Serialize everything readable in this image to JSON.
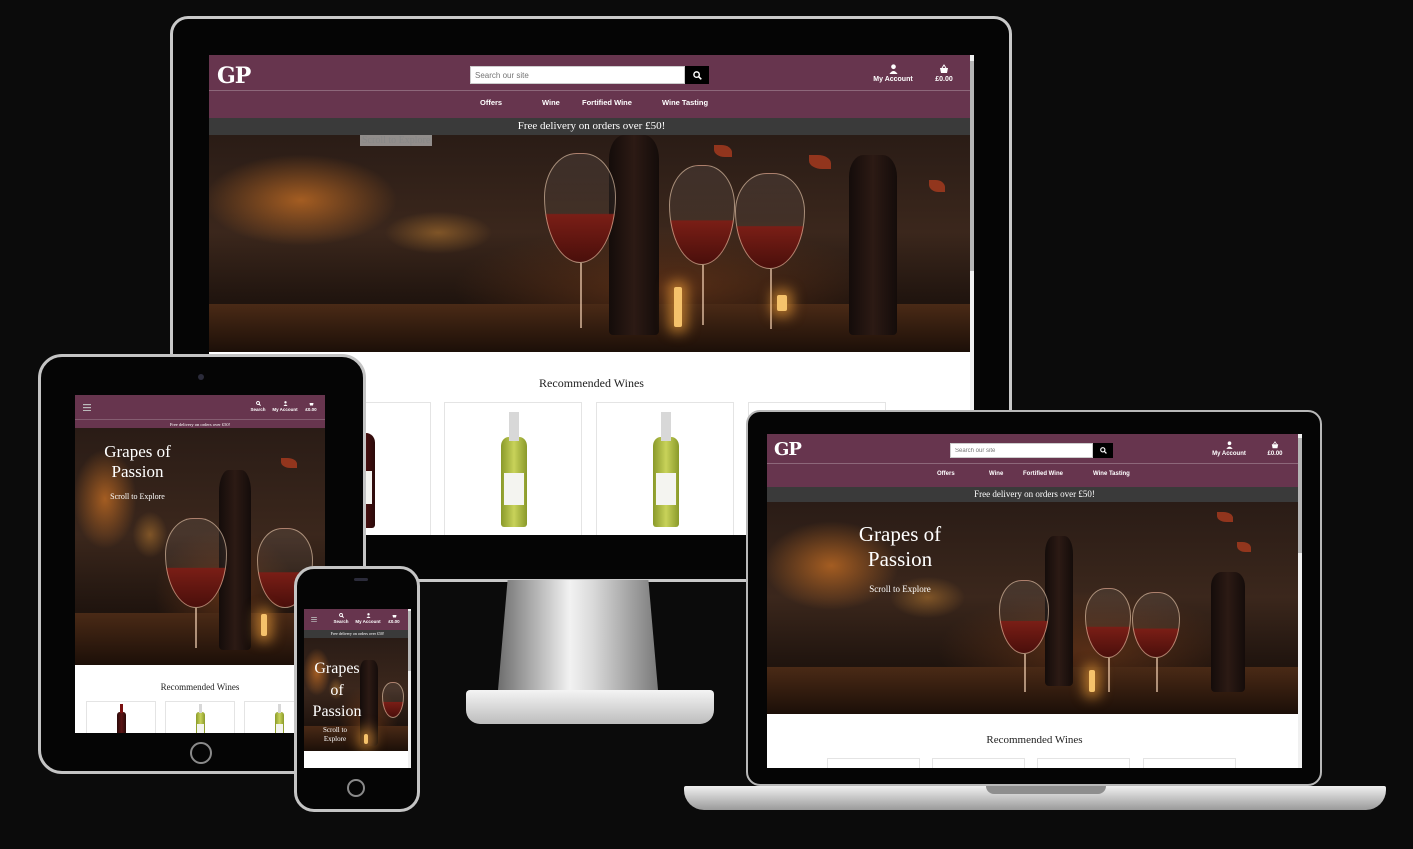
{
  "brand": {
    "logo_text": "GP",
    "primary_color": "#67354e",
    "banner_color": "#3a3a3a"
  },
  "search": {
    "placeholder": "Search our site",
    "label": "Search"
  },
  "account": {
    "label": "My Account",
    "cart_total": "£0.00"
  },
  "nav": {
    "items": [
      "Offers",
      "Wine",
      "Fortified Wine",
      "Wine Tasting"
    ]
  },
  "banner": {
    "text": "Free delivery on orders over £50!"
  },
  "hero": {
    "title": "Grapes of Passion",
    "subtitle": "Scroll to Explore"
  },
  "products": {
    "heading": "Recommended Wines"
  },
  "icons": [
    "user-icon",
    "basket-icon",
    "search-icon",
    "hamburger-icon"
  ]
}
